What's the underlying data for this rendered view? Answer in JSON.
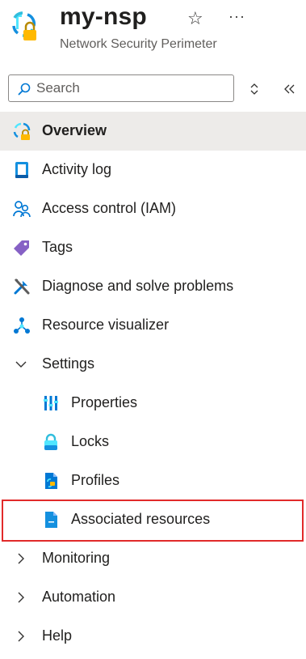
{
  "header": {
    "title": "my-nsp",
    "subtitle": "Network Security Perimeter",
    "star_icon": "star-icon",
    "more_icon": "more-icon"
  },
  "search": {
    "placeholder": "Search",
    "value": ""
  },
  "nav": {
    "overview": "Overview",
    "activity_log": "Activity log",
    "access_control": "Access control (IAM)",
    "tags": "Tags",
    "diagnose": "Diagnose and solve problems",
    "resource_visualizer": "Resource visualizer",
    "settings": "Settings",
    "properties": "Properties",
    "locks": "Locks",
    "profiles": "Profiles",
    "associated_resources": "Associated resources",
    "monitoring": "Monitoring",
    "automation": "Automation",
    "help": "Help"
  },
  "colors": {
    "accent": "#0078d4",
    "active_bg": "#edebe9",
    "highlight": "#e12a2a"
  }
}
